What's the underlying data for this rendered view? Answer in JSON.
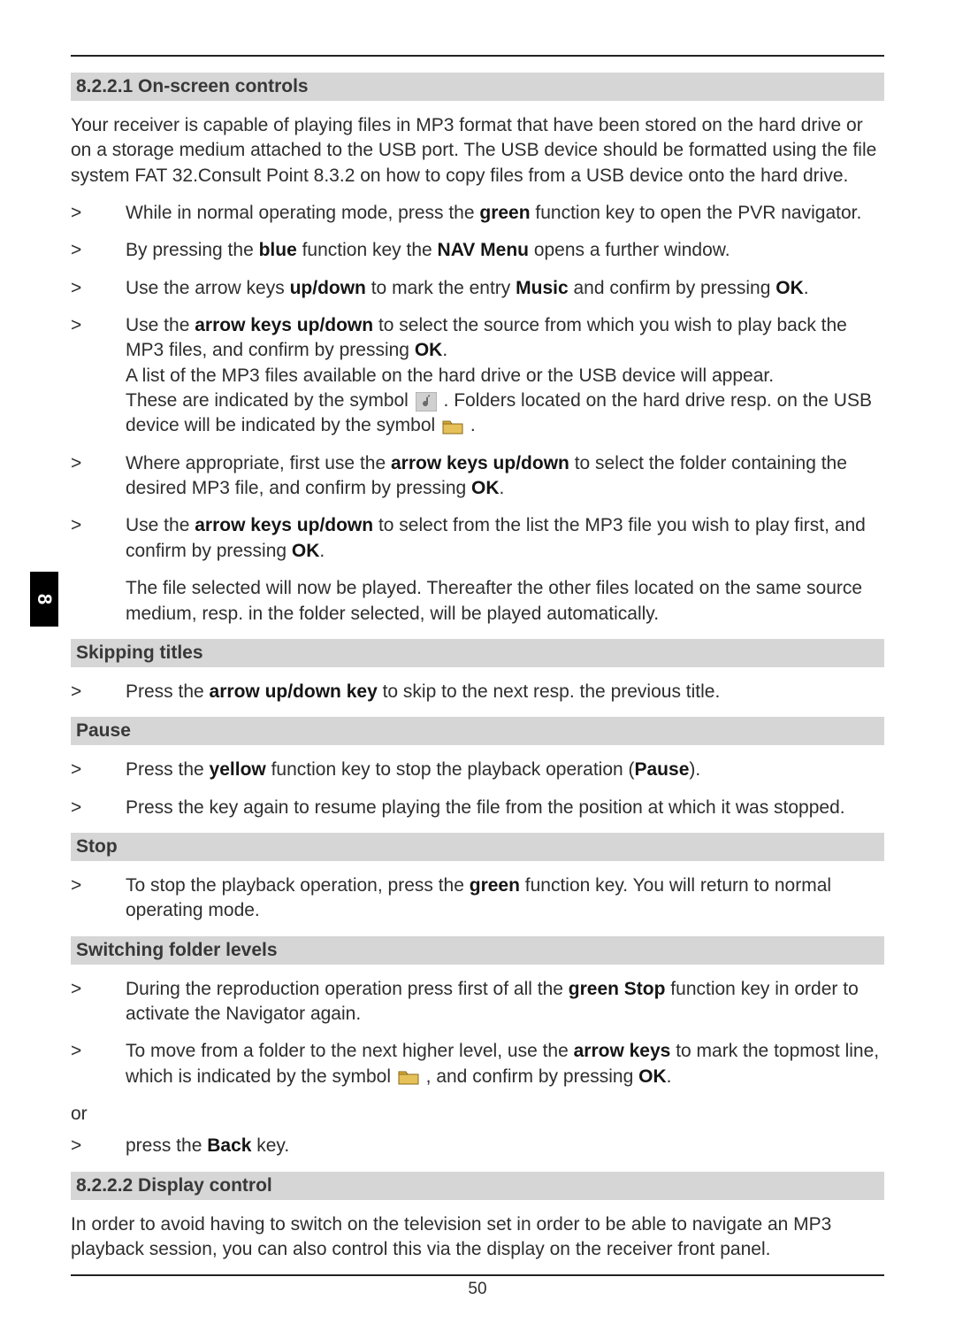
{
  "page_number": "50",
  "tab": "8",
  "h1": "8.2.2.1 On-screen controls",
  "intro": "Your receiver is capable of playing files in MP3 format that have been stored on the hard drive or on a storage medium attached to the USB port. The USB device should be formatted using the file system FAT 32.Consult Point 8.3.2 on how to copy files from a USB device onto the hard drive.",
  "b1a": "While in normal operating mode, press the ",
  "b1_green": "green",
  "b1b": " function key to open the PVR navigator.",
  "b2a": "By pressing the ",
  "b2_blue": "blue",
  "b2b": " function key the ",
  "b2_nav": "NAV Menu",
  "b2c": " opens a further window.",
  "b3a": "Use the arrow keys ",
  "b3_ud": "up/down",
  "b3b": " to mark the entry ",
  "b3_music": "Music",
  "b3c": " and confirm by pressing ",
  "b3_ok": "OK",
  "b3d": ".",
  "b4a": "Use the ",
  "b4_ak": "arrow keys up/down",
  "b4b": " to select the source from which you wish to play back the MP3 files, and confirm by pressing ",
  "b4_ok": "OK",
  "b4c": ".",
  "b4d": "A list of the MP3 files available on the hard drive or the USB device will appear.",
  "b4e": "These are indicated by the symbol ",
  "b4f": " . Folders located on the hard drive resp. on the USB device will be indicated by the symbol ",
  "b4g": " .",
  "b5a": "Where appropriate, first use the ",
  "b5_ak": "arrow keys up/down",
  "b5b": " to select the folder containing the desired MP3 file, and confirm by pressing ",
  "b5_ok": "OK",
  "b5c": ".",
  "b6a": "Use the ",
  "b6_ak": "arrow keys up/down",
  "b6b": " to select from the list the MP3 file you wish to play first, and confirm by pressing ",
  "b6_ok": "OK",
  "b6c": ".",
  "b6d": "The file selected will now be played. Thereafter the other files located on the same source medium, resp. in the folder selected, will be played automatically.",
  "h2": "Skipping titles",
  "s1a": "Press the ",
  "s1_ak": "arrow up/down key",
  "s1b": " to skip to the next resp. the previous title.",
  "h3": "Pause",
  "p1a": "Press the ",
  "p1_y": "yellow",
  "p1b": " function key to stop the playback operation (",
  "p1_pause": "Pause",
  "p1c": ").",
  "p2": "Press the key again to resume playing the file from the position at which it was stopped.",
  "h4": "Stop",
  "st1a": "To stop the playback operation, press the ",
  "st1_g": "green",
  "st1b": " function key. You will return to normal operating mode.",
  "h5": "Switching folder levels",
  "sw1a": "During the reproduction operation press first of all the ",
  "sw1_gs": "green Stop",
  "sw1b": " function key in order to activate the Navigator again.",
  "sw2a": "To move from a folder to the next higher level, use the ",
  "sw2_ak": "arrow keys",
  "sw2b": " to mark the topmost line, which is indicated by the symbol ",
  "sw2c": " , and confirm by pressing ",
  "sw2_ok": "OK",
  "sw2d": ".",
  "or": "or",
  "sw3a": "press the ",
  "sw3_back": "Back",
  "sw3b": " key.",
  "h6": "8.2.2.2 Display control",
  "dc": "In order to avoid having to switch on the television set in order to be able to navigate an MP3 playback session, you can also control this via the display on the receiver front panel."
}
